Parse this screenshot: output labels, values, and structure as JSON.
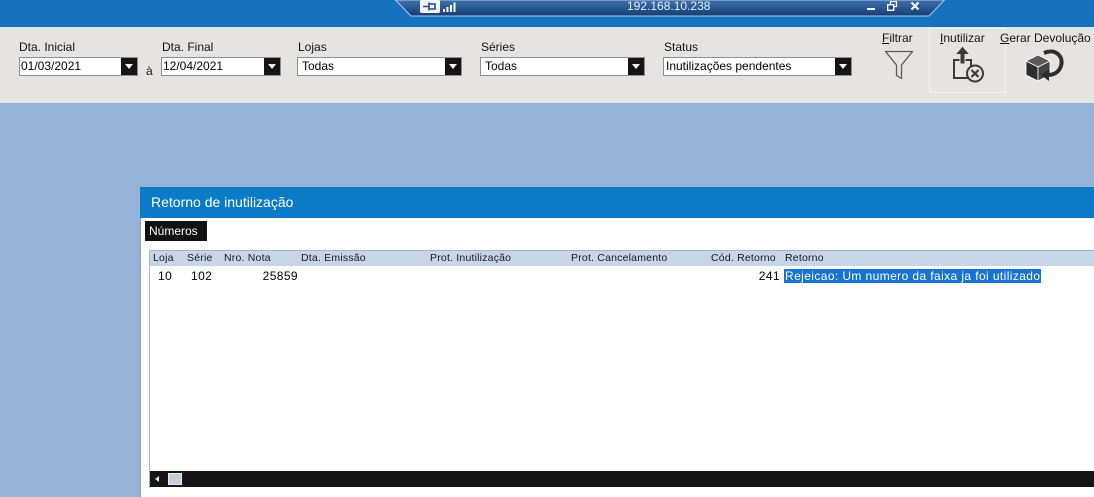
{
  "rdp_bar": {
    "host": "192.168.10.238",
    "icons": {
      "pin": "pin-icon",
      "connection_quality": "signal-bars-icon",
      "minimize": "minimize-icon",
      "restore": "restore-icon",
      "close": "close-icon"
    }
  },
  "filters": {
    "date_start": {
      "label": "Dta. Inicial",
      "value": "01/03/2021"
    },
    "date_separator": "à",
    "date_end": {
      "label": "Dta. Final",
      "value": "12/04/2021"
    },
    "stores": {
      "label": "Lojas",
      "value": "Todas"
    },
    "series": {
      "label": "Séries",
      "value": "Todas"
    },
    "status": {
      "label": "Status",
      "value": "Inutilizações pendentes"
    },
    "dropdown_icon": "dropdown-arrow-icon"
  },
  "actions": [
    {
      "label": "Filtrar",
      "icon": "funnel-icon"
    },
    {
      "label": "Inutilizar",
      "icon": "box-cancel-icon"
    },
    {
      "label": "Gerar Devolução",
      "icon": "box-return-icon"
    }
  ],
  "panel": {
    "title": "Retorno de inutilização",
    "tab": "Números",
    "grid": {
      "columns": [
        "Loja",
        "Série",
        "Nro. Nota",
        "Dta. Emissão",
        "Prot. Inutilização",
        "Prot. Cancelamento",
        "Cód. Retorno",
        "Retorno"
      ],
      "rows": [
        {
          "cells": [
            "10",
            "102",
            "25859",
            "",
            "",
            "",
            "241",
            "Rejeicao: Um numero da faixa ja foi utilizado"
          ]
        }
      ]
    },
    "scrollbar": {
      "left_arrow_icon": "scroll-left-arrow-icon",
      "horizontal_position": 0
    }
  },
  "colors": {
    "rdp-bar": "#1672bd",
    "toolbar": "#e6e3e3",
    "workspace": "#95b3d7",
    "title-bar": "#0b7bc8",
    "selection": "#1673d1"
  }
}
